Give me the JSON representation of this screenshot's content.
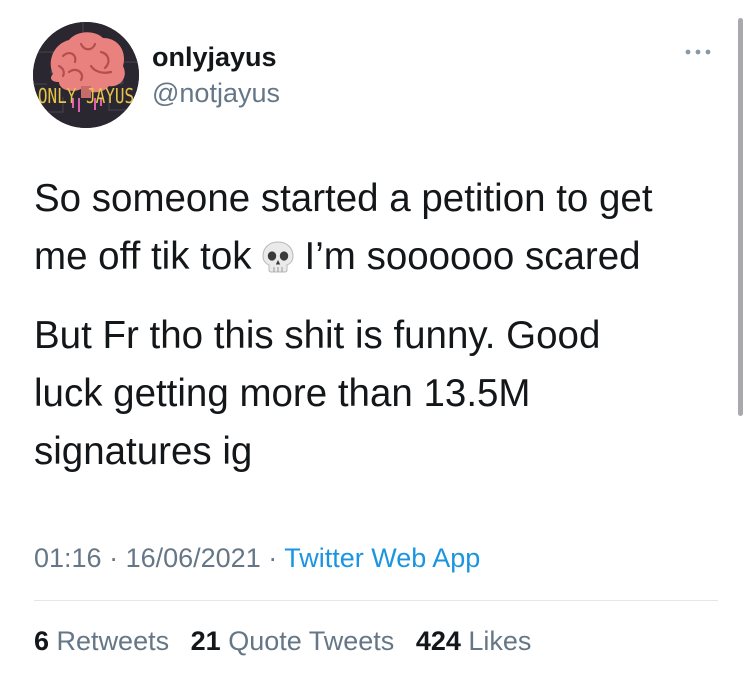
{
  "tweet": {
    "avatar_icon": "brain-logo-icon",
    "avatar_text": "ONLY JAYUS",
    "display_name": "onlyjayus",
    "handle": "@notjayus",
    "more_icon": "more-horizontal-icon",
    "text_line1": "So someone started a petition to get",
    "text_line2a": "me off tik tok",
    "emoji": "skull-icon",
    "text_line2b": "I’m soooooo scared",
    "text2_line1": "But Fr tho this shit is funny. Good",
    "text2_line2": "luck getting more than 13.5M",
    "text2_line3": "signatures ig",
    "time": "01:16",
    "separator": " · ",
    "date": "16/06/2021",
    "app": "Twitter Web App",
    "stats": {
      "retweets_count": "6",
      "retweets_label": "Retweets",
      "quotes_count": "21",
      "quotes_label": "Quote Tweets",
      "likes_count": "424",
      "likes_label": "Likes"
    }
  },
  "colors": {
    "primary_text": "#14171a",
    "secondary_text": "#657786",
    "link": "#1b95e0",
    "divider": "#e1e8ed"
  }
}
